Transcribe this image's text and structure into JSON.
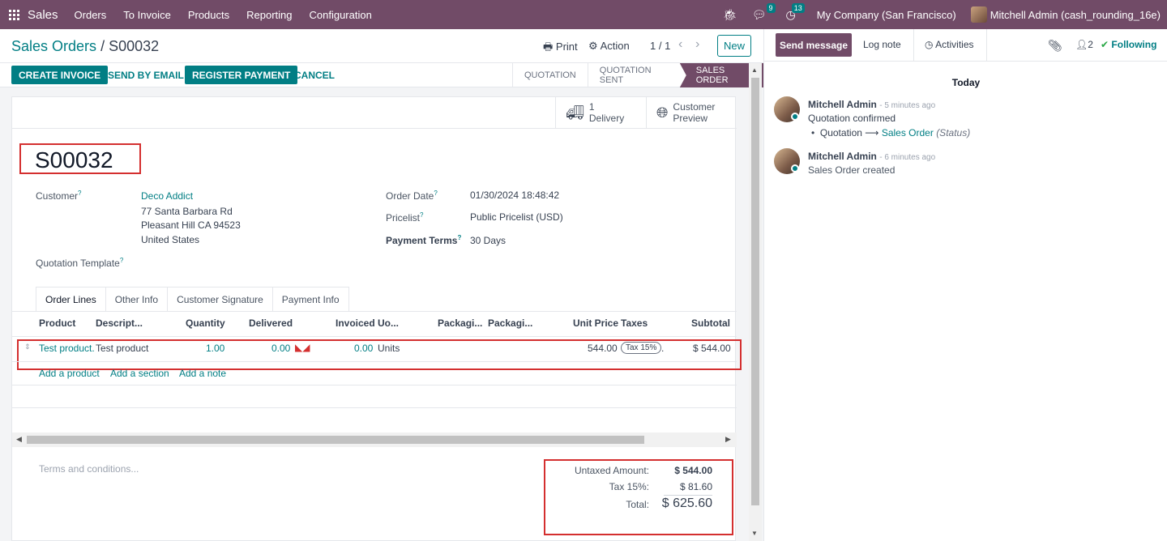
{
  "topbar": {
    "app": "Sales",
    "menu": [
      "Orders",
      "To Invoice",
      "Products",
      "Reporting",
      "Configuration"
    ],
    "messages_badge": "9",
    "activities_badge": "13",
    "company": "My Company (San Francisco)",
    "user": "Mitchell Admin (cash_rounding_16e)"
  },
  "control": {
    "breadcrumb_parent": "Sales Orders",
    "breadcrumb_sep": "/",
    "breadcrumb_current": "S00032",
    "print": "Print",
    "action": "Action",
    "pager": "1 / 1",
    "new": "New"
  },
  "statusbar": {
    "buttons": [
      "CREATE INVOICE",
      "SEND BY EMAIL",
      "REGISTER PAYMENT",
      "CANCEL"
    ],
    "stages": [
      "QUOTATION",
      "QUOTATION SENT",
      "SALES ORDER"
    ],
    "active_stage": "SALES ORDER"
  },
  "smart_buttons": {
    "delivery_count": "1",
    "delivery_label": "Delivery",
    "preview_line1": "Customer",
    "preview_line2": "Preview"
  },
  "form": {
    "name": "S00032",
    "customer_label": "Customer",
    "customer_name": "Deco Addict",
    "address1": "77 Santa Barbara Rd",
    "address2": "Pleasant Hill CA 94523",
    "address3": "United States",
    "template_label": "Quotation Template",
    "order_date_label": "Order Date",
    "order_date": "01/30/2024 18:48:42",
    "pricelist_label": "Pricelist",
    "pricelist": "Public Pricelist (USD)",
    "terms_label": "Payment Terms",
    "terms": "30 Days"
  },
  "tabs": [
    "Order Lines",
    "Other Info",
    "Customer Signature",
    "Payment Info"
  ],
  "table": {
    "headers": [
      "Product",
      "Descript...",
      "Quantity",
      "Delivered",
      "Invoiced",
      "Uo...",
      "Packagi...",
      "Packagi...",
      "Unit Price",
      "Taxes",
      "Subtotal"
    ],
    "row": {
      "product": "Test product.",
      "description": "Test product",
      "quantity": "1.00",
      "delivered": "0.00",
      "invoiced": "0.00",
      "uom": "Units",
      "unit_price": "544.00",
      "tax": "Tax 15%",
      "tax_suffix": ".",
      "subtotal": "$ 544.00"
    },
    "add_product": "Add a product",
    "add_section": "Add a section",
    "add_note": "Add a note"
  },
  "footer": {
    "terms_placeholder": "Terms and conditions...",
    "untaxed_label": "Untaxed Amount:",
    "untaxed": "$ 544.00",
    "tax_label": "Tax 15%:",
    "tax": "$ 81.60",
    "total_label": "Total:",
    "total": "$ 625.60"
  },
  "chatter": {
    "send_message": "Send message",
    "log_note": "Log note",
    "activities": "Activities",
    "followers_count": "2",
    "following": "Following",
    "today": "Today",
    "messages": [
      {
        "author": "Mitchell Admin",
        "ago": "- 5 minutes ago",
        "body": "Quotation confirmed",
        "from": "Quotation",
        "to": "Sales Order",
        "field": "(Status)"
      },
      {
        "author": "Mitchell Admin",
        "ago": "- 6 minutes ago",
        "body": "Sales Order created"
      }
    ]
  },
  "colors": {
    "brand": "#714b67",
    "accent": "#017e84",
    "highlight_box": "#d42f2f"
  }
}
